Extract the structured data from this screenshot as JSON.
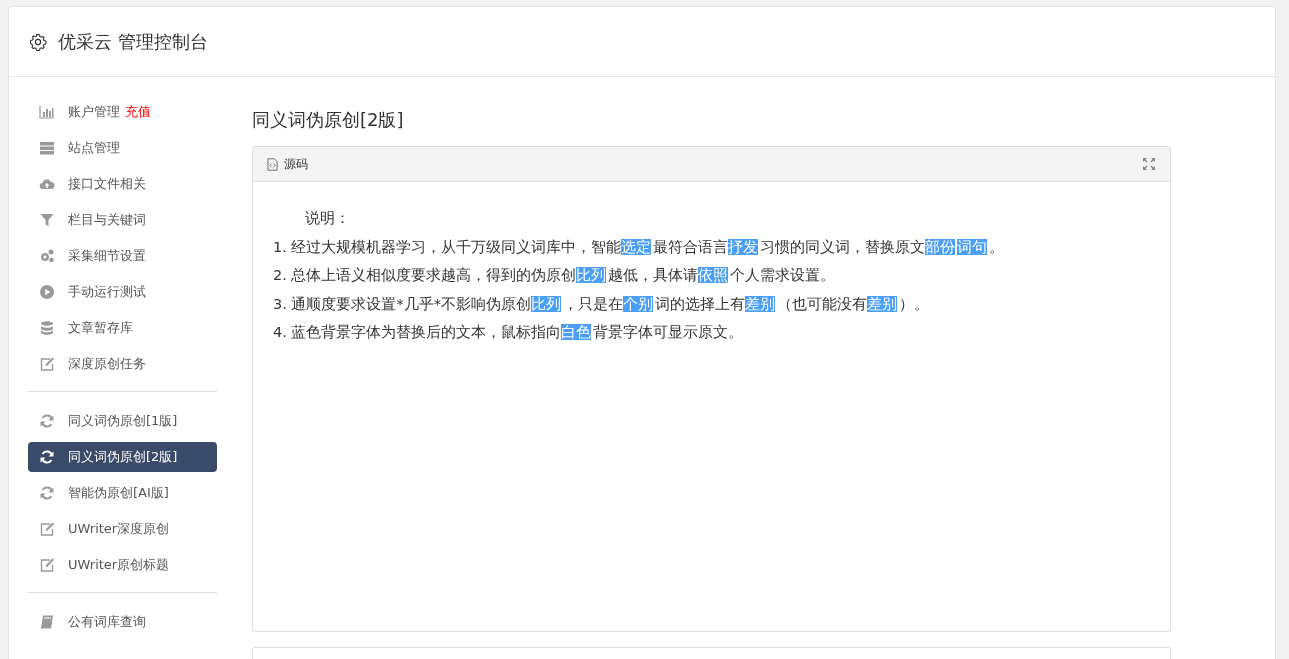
{
  "header": {
    "title": "优采云 管理控制台"
  },
  "sidebar": {
    "groups": [
      {
        "items": [
          {
            "kind": "chart",
            "label": "账户管理",
            "badge": "充值",
            "selected": false
          },
          {
            "kind": "server",
            "label": "站点管理",
            "selected": false
          },
          {
            "kind": "cloud",
            "label": "接口文件相关",
            "selected": false
          },
          {
            "kind": "filter",
            "label": "栏目与关键词",
            "selected": false
          },
          {
            "kind": "gears",
            "label": "采集细节设置",
            "selected": false
          },
          {
            "kind": "play",
            "label": "手动运行测试",
            "selected": false
          },
          {
            "kind": "database",
            "label": "文章暂存库",
            "selected": false
          },
          {
            "kind": "edit",
            "label": "深度原创任务",
            "selected": false
          }
        ]
      },
      {
        "items": [
          {
            "kind": "refresh",
            "label": "同义词伪原创[1版]",
            "selected": false
          },
          {
            "kind": "refresh",
            "label": "同义词伪原创[2版]",
            "selected": true
          },
          {
            "kind": "refresh",
            "label": "智能伪原创[AI版]",
            "selected": false
          },
          {
            "kind": "edit",
            "label": "UWriter深度原创",
            "selected": false
          },
          {
            "kind": "edit",
            "label": "UWriter原创标题",
            "selected": false
          }
        ]
      },
      {
        "items": [
          {
            "kind": "book",
            "label": "公有词库查询",
            "selected": false
          }
        ]
      }
    ]
  },
  "main": {
    "title": "同义词伪原创[2版]",
    "editor": {
      "tool_label": "源码",
      "heading": "说明：",
      "lines": [
        [
          {
            "text": "1. 经过大规模机器学习，从千万级同义词库中，智能"
          },
          {
            "text": "选定",
            "highlight": true
          },
          {
            "text": "最符合语言"
          },
          {
            "text": "抒发",
            "highlight": true
          },
          {
            "text": "习惯的同义词，替换原文"
          },
          {
            "text": "部份",
            "highlight": true
          },
          {
            "text": "词句",
            "highlight": true
          },
          {
            "text": "。"
          }
        ],
        [
          {
            "text": "2. 总体上语义相似度要求越高，得到的伪原创"
          },
          {
            "text": "比列",
            "highlight": true
          },
          {
            "text": "越低，具体请"
          },
          {
            "text": "依照",
            "highlight": true
          },
          {
            "text": "个人需求设置。"
          }
        ],
        [
          {
            "text": "3. 通顺度要求设置*几乎*不影响伪原创"
          },
          {
            "text": "比列",
            "highlight": true
          },
          {
            "text": "，只是在"
          },
          {
            "text": "个别",
            "highlight": true
          },
          {
            "text": "词的选择上有"
          },
          {
            "text": "差别",
            "highlight": true
          },
          {
            "text": "（也可能没有"
          },
          {
            "text": "差别",
            "highlight": true
          },
          {
            "text": "）。"
          }
        ],
        [
          {
            "text": "4. 蓝色背景字体为替换后的文本，鼠标指向"
          },
          {
            "text": "白色",
            "highlight": true
          },
          {
            "text": "背景字体可显示原文。"
          }
        ]
      ]
    }
  }
}
